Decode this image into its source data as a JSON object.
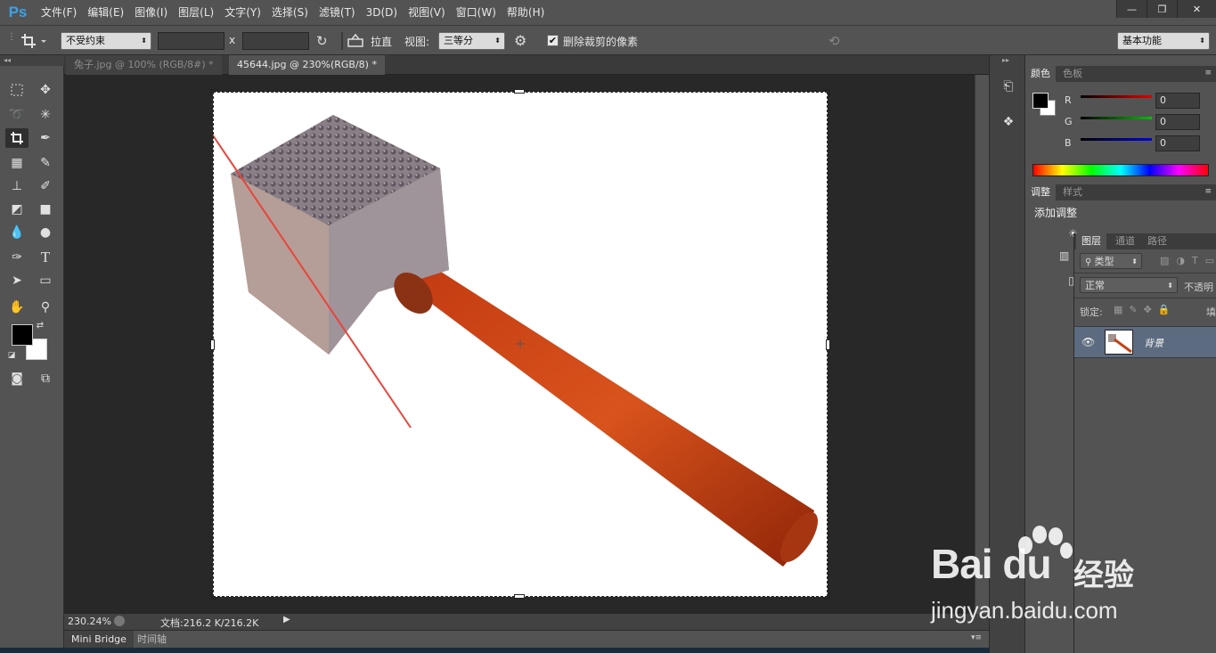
{
  "app": {
    "logo": "Ps"
  },
  "menu": [
    "文件(F)",
    "编辑(E)",
    "图像(I)",
    "图层(L)",
    "文字(Y)",
    "选择(S)",
    "滤镜(T)",
    "3D(D)",
    "视图(V)",
    "窗口(W)",
    "帮助(H)"
  ],
  "window_controls": {
    "minimize": "—",
    "restore": "❐",
    "close": "✕"
  },
  "options": {
    "constraint": "不受约束",
    "x_sep": "x",
    "straighten": "拉直",
    "view_label": "视图:",
    "view_value": "三等分",
    "delete_cropped": "删除裁剪的像素",
    "delete_checked": "✔",
    "workspace": "基本功能"
  },
  "tabs": [
    {
      "label": "兔子.jpg @ 100% (RGB/8#) *",
      "active": false
    },
    {
      "label": "45644.jpg @ 230%(RGB/8) *",
      "active": true
    }
  ],
  "status": {
    "zoom": "230.24%",
    "doc_info": "文档:216.2 K/216.2K"
  },
  "bottom_tabs": [
    "Mini Bridge",
    "时间轴"
  ],
  "color_panel": {
    "tabs": [
      "颜色",
      "色板"
    ],
    "channels": [
      {
        "label": "R",
        "value": "0",
        "color": "#e00000"
      },
      {
        "label": "G",
        "value": "0",
        "color": "#00c000"
      },
      {
        "label": "B",
        "value": "0",
        "color": "#0000e0"
      }
    ]
  },
  "adjust_panel": {
    "tabs": [
      "调整",
      "样式"
    ],
    "title": "添加调整"
  },
  "layers_panel": {
    "tabs": [
      "图层",
      "通道",
      "路径"
    ],
    "filter_type": "类型",
    "blend_mode": "正常",
    "opacity_label": "不透明",
    "lock_label": "锁定:",
    "fill_label": "填",
    "layers": [
      {
        "name": "背景"
      }
    ]
  },
  "watermark": {
    "logo": "Bai du",
    "cn": "经验",
    "url": "jingyan.baidu.com"
  }
}
